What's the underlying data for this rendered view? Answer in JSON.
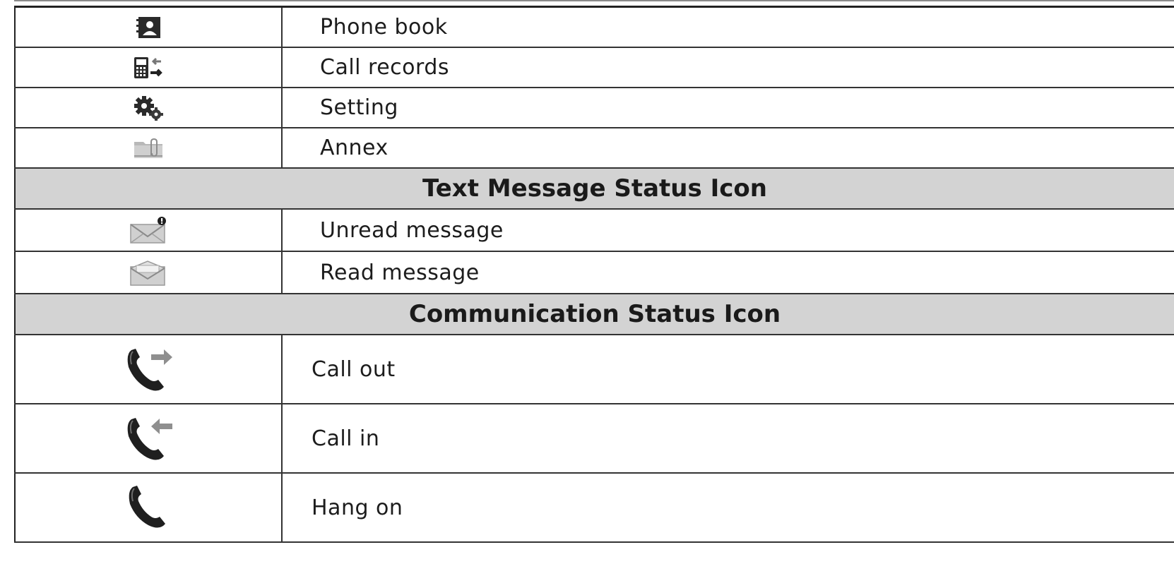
{
  "rows": [
    {
      "kind": "item",
      "size": "small",
      "icon": "phone-book-icon",
      "label": "Phone book"
    },
    {
      "kind": "item",
      "size": "small",
      "icon": "call-records-icon",
      "label": "Call records"
    },
    {
      "kind": "item",
      "size": "small",
      "icon": "gears-icon",
      "label": "Setting"
    },
    {
      "kind": "item",
      "size": "small",
      "icon": "paperclip-folder-icon",
      "label": "Annex"
    },
    {
      "kind": "section",
      "label": "Text Message Status Icon"
    },
    {
      "kind": "item",
      "size": "msg",
      "icon": "unread-envelope-icon",
      "label": "Unread message"
    },
    {
      "kind": "item",
      "size": "msg",
      "icon": "read-envelope-icon",
      "label": "Read message"
    },
    {
      "kind": "section",
      "label": "Communication Status Icon"
    },
    {
      "kind": "item",
      "size": "call",
      "icon": "call-out-icon",
      "label": "Call out"
    },
    {
      "kind": "item",
      "size": "call",
      "icon": "call-in-icon",
      "label": "Call in"
    },
    {
      "kind": "item",
      "size": "call",
      "icon": "handset-icon",
      "label": "Hang on"
    }
  ],
  "colors": {
    "section_bg": "#d3d3d3",
    "border": "#333333",
    "text": "#1c1c1c"
  }
}
